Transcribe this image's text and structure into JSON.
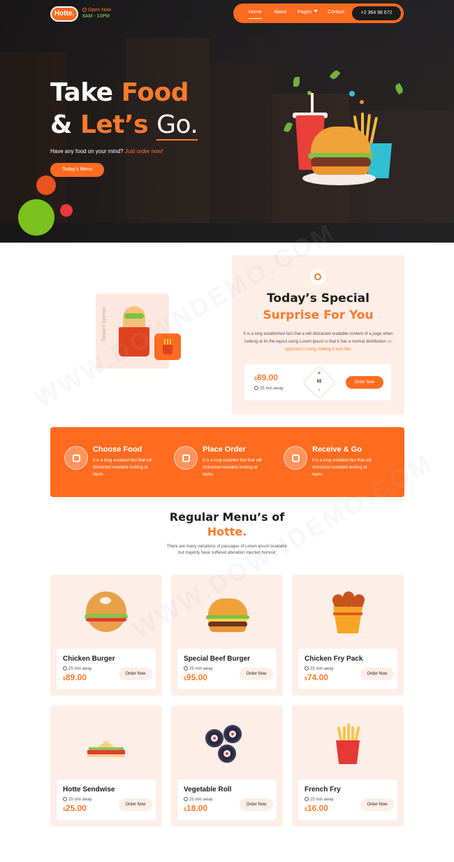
{
  "header": {
    "logo": "Hotte.",
    "open_label": "Open Now",
    "hours": "8AM - 10PM",
    "nav": [
      "Home",
      "About",
      "Pages",
      "Contact"
    ],
    "phone": "+2 364 98 672"
  },
  "hero": {
    "title_line1_a": "Take ",
    "title_line1_b": "Food",
    "title_line2_a": "& ",
    "title_line2_b": "Let’s ",
    "title_line2_c": "Go.",
    "subtitle_a": "Have any food on your mind? ",
    "subtitle_b": "Just order now!",
    "button": "Today's Menu"
  },
  "special": {
    "vertical_label": "Today's Special",
    "title_1": "Today’s Special",
    "title_2": "Surprise For You",
    "desc_a": "It is a long established fact that a will distracted readable content of a page when looking at its the layout using Lorem ipsum is that it has a normal distribution ",
    "desc_b": "as opposed to using making it look like.",
    "currency": "$",
    "price": "89.00",
    "away": "25 min away",
    "qty_plus": "+",
    "qty": "02",
    "qty_minus": "-",
    "order_button": "Order Now"
  },
  "steps": [
    {
      "title": "Choose Food",
      "desc": "It is a long establed fact that will distracted readable looking at layou."
    },
    {
      "title": "Place Order",
      "desc": "It is a long establed fact that will distracted readable looking at layou."
    },
    {
      "title": "Receive & Go",
      "desc": "It is a long establed fact that will distracted readable looking at layou."
    }
  ],
  "menu": {
    "title_1": "Regular Menu’s of",
    "title_2": "Hotte.",
    "desc": "There are many variations of passages of Lorem ipsum available but majority have suffered alteration injected humour",
    "items": [
      {
        "name": "Chicken Burger",
        "away": "25 min away",
        "currency": "$",
        "price": "89.00",
        "button": "Order Now",
        "icon": "bagel-sandwich-icon"
      },
      {
        "name": "Special Beef Burger",
        "away": "25 min away",
        "currency": "$",
        "price": "95.00",
        "button": "Order Now",
        "icon": "burger-icon"
      },
      {
        "name": "Chicken Fry Pack",
        "away": "25 min away",
        "currency": "$",
        "price": "74.00",
        "button": "Order Now",
        "icon": "chicken-bucket-icon"
      },
      {
        "name": "Hotte Sendwise",
        "away": "25 min away",
        "currency": "$",
        "price": "25.00",
        "button": "Order Now",
        "icon": "sandwich-icon"
      },
      {
        "name": "Vegetable Roll",
        "away": "25 min away",
        "currency": "$",
        "price": "18.00",
        "button": "Order Now",
        "icon": "sushi-roll-icon"
      },
      {
        "name": "French Fry",
        "away": "25 min away",
        "currency": "$",
        "price": "16.00",
        "button": "Order Now",
        "icon": "french-fries-icon"
      }
    ]
  },
  "watermark": "WWW.DOWNDEMO.COM",
  "colors": {
    "accent": "#ff6b1f",
    "accent_text": "#ff7a2c",
    "card_bg": "#fdeee7",
    "dark": "#1d1d1d"
  }
}
